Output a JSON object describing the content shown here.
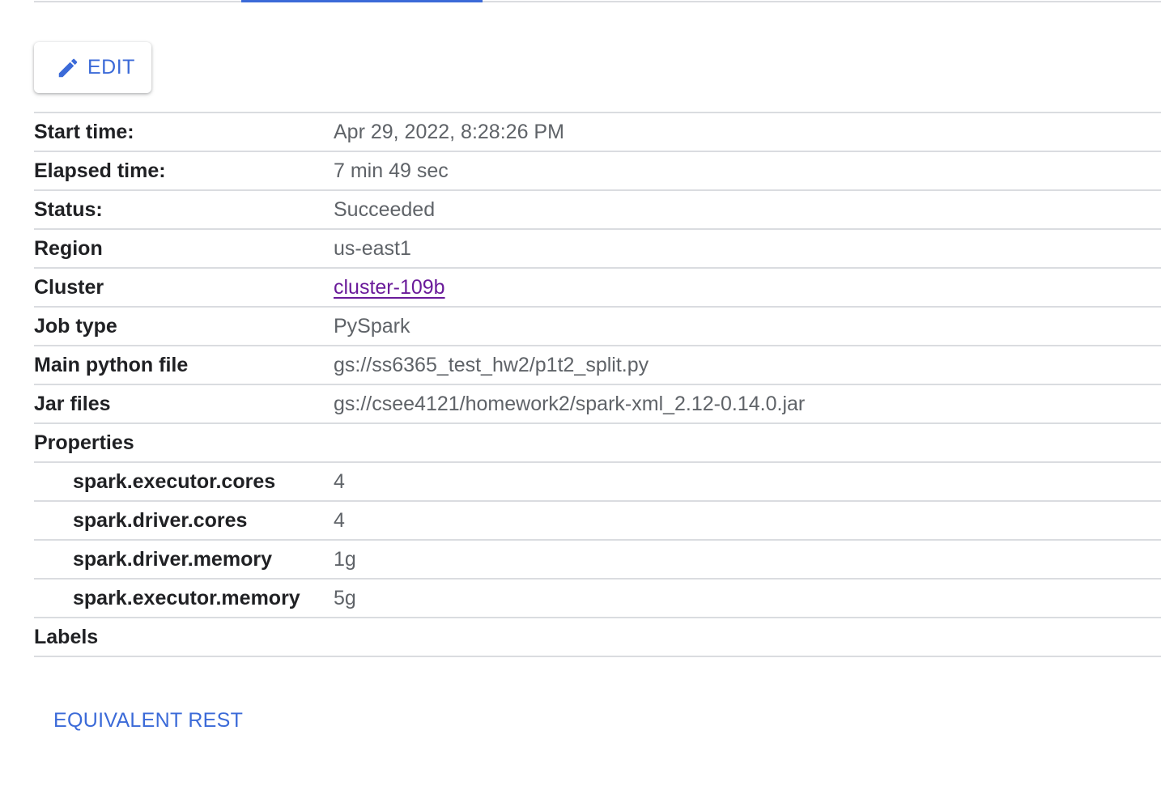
{
  "edit_button": {
    "label": "EDIT",
    "icon": "pencil-icon"
  },
  "details": {
    "start_time": {
      "key": "Start time:",
      "value": "Apr 29, 2022, 8:28:26 PM"
    },
    "elapsed_time": {
      "key": "Elapsed time:",
      "value": "7 min 49 sec"
    },
    "status": {
      "key": "Status:",
      "value": "Succeeded"
    },
    "region": {
      "key": "Region",
      "value": "us-east1"
    },
    "cluster": {
      "key": "Cluster",
      "value": "cluster-109b"
    },
    "job_type": {
      "key": "Job type",
      "value": "PySpark"
    },
    "main_python_file": {
      "key": "Main python file",
      "value": "gs://ss6365_test_hw2/p1t2_split.py"
    },
    "jar_files": {
      "key": "Jar files",
      "value": "gs://csee4121/homework2/spark-xml_2.12-0.14.0.jar"
    },
    "properties": {
      "key": "Properties",
      "items": [
        {
          "key": "spark.executor.cores",
          "value": "4"
        },
        {
          "key": "spark.driver.cores",
          "value": "4"
        },
        {
          "key": "spark.driver.memory",
          "value": "1g"
        },
        {
          "key": "spark.executor.memory",
          "value": "5g"
        }
      ]
    },
    "labels": {
      "key": "Labels"
    }
  },
  "equivalent_rest": {
    "label": "EQUIVALENT REST"
  },
  "colors": {
    "accent": "#3b6ad8",
    "link_visited": "#6a1b9a",
    "divider": "#dadce0",
    "key_text": "#202124",
    "value_text": "#5f6368"
  }
}
